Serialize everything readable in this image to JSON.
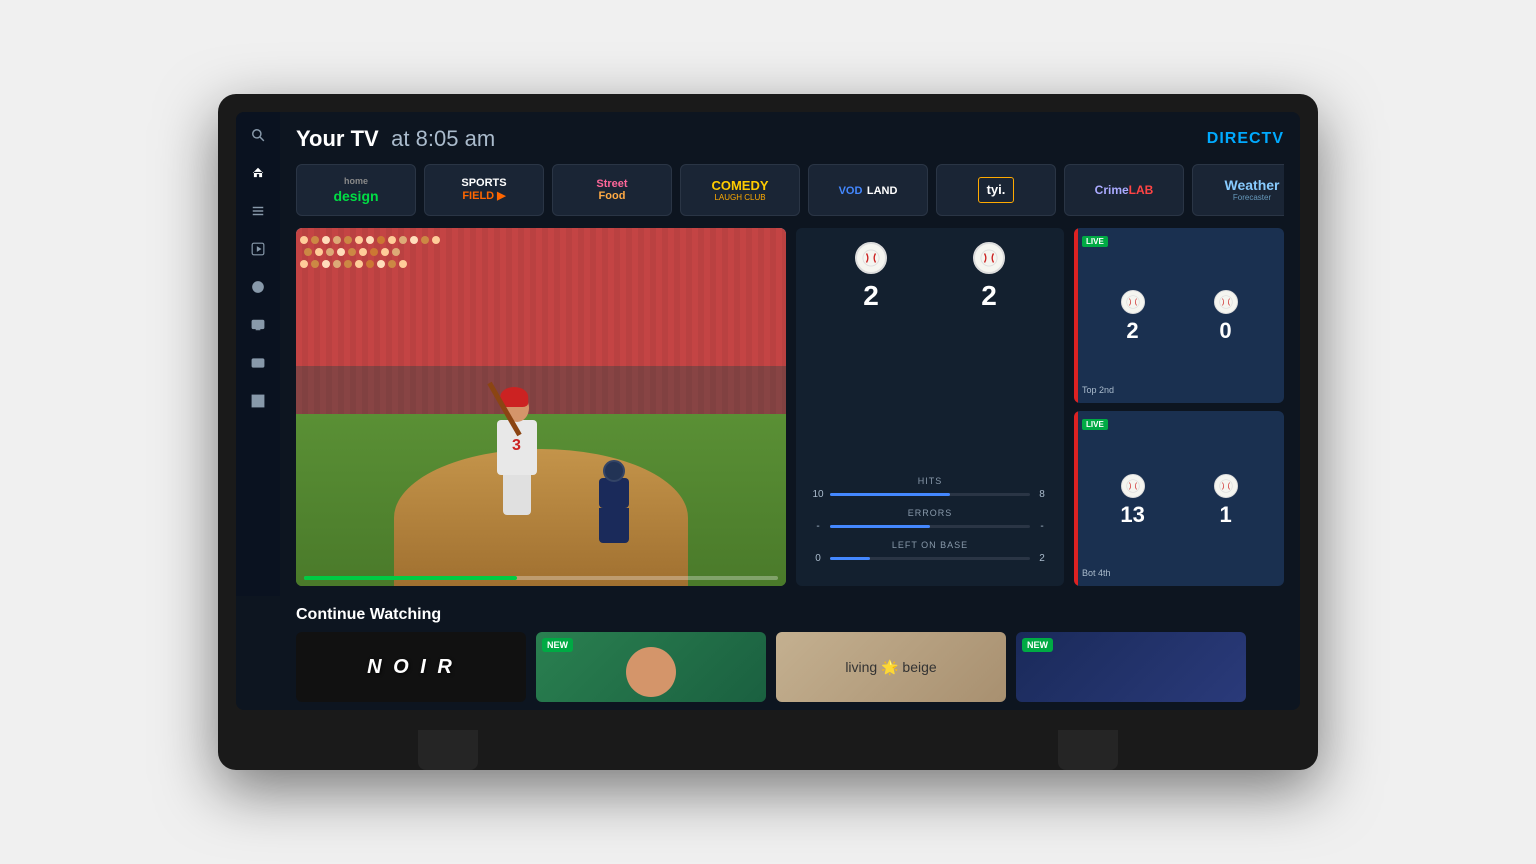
{
  "tv": {
    "brand": "DIRECTV"
  },
  "header": {
    "title": "Your TV",
    "time_prefix": "at",
    "time": "8:05 am"
  },
  "channels": [
    {
      "id": "home-design",
      "label": "home design",
      "style": "home-design"
    },
    {
      "id": "sports-field",
      "label": "SPORTS FIELD",
      "style": "sports"
    },
    {
      "id": "street-food",
      "label": "Street Food",
      "style": "street-food"
    },
    {
      "id": "comedy",
      "label": "COMEDY",
      "sublabel": "LAUGH CLUB",
      "style": "comedy"
    },
    {
      "id": "vodland",
      "label": "VOD LAND",
      "style": "vodland"
    },
    {
      "id": "tyi",
      "label": "tyi.",
      "style": "tyi"
    },
    {
      "id": "crimelab",
      "label": "CrimeLAB",
      "style": "crimelab"
    },
    {
      "id": "weather",
      "label": "Weather",
      "sublabel": "Forecaster",
      "style": "weather"
    }
  ],
  "game": {
    "score1": "2",
    "score2": "2",
    "hits_label": "HITS",
    "hits_val1": "10",
    "hits_val2": "8",
    "hits_pct": "60",
    "errors_label": "ERRORS",
    "errors_val1": "-",
    "errors_val2": "-",
    "left_on_base_label": "LEFT ON BASE",
    "lob_val1": "0",
    "lob_val2": "2",
    "lob_pct": "20",
    "player_number": "3"
  },
  "game_tiles": [
    {
      "score1": "2",
      "score2": "0",
      "live": "LIVE",
      "status": "Top 2nd"
    },
    {
      "score1": "13",
      "score2": "1",
      "live": "LIVE",
      "status": "Bot 4th"
    }
  ],
  "continue_watching": {
    "title": "Continue Watching",
    "cards": [
      {
        "id": "noir",
        "label": "N O I R",
        "type": "noir"
      },
      {
        "id": "green-show",
        "label": "",
        "type": "green",
        "badge": "NEW"
      },
      {
        "id": "living-beige",
        "label": "living 🌟 beige",
        "type": "beige"
      },
      {
        "id": "blue-show",
        "label": "",
        "type": "blue",
        "badge": "NEW"
      }
    ]
  },
  "sidebar": {
    "icons": [
      {
        "id": "search",
        "symbol": "🔍",
        "active": false
      },
      {
        "id": "home",
        "symbol": "⌂",
        "active": true
      },
      {
        "id": "list",
        "symbol": "≡",
        "active": false
      },
      {
        "id": "play",
        "symbol": "▶",
        "active": false
      },
      {
        "id": "tag",
        "symbol": "◈",
        "active": false
      },
      {
        "id": "screen",
        "symbol": "⬜",
        "active": false
      },
      {
        "id": "dollar",
        "symbol": "$",
        "active": false
      },
      {
        "id": "grid",
        "symbol": "⊞",
        "active": false
      }
    ]
  },
  "progress": {
    "pct": 45
  }
}
